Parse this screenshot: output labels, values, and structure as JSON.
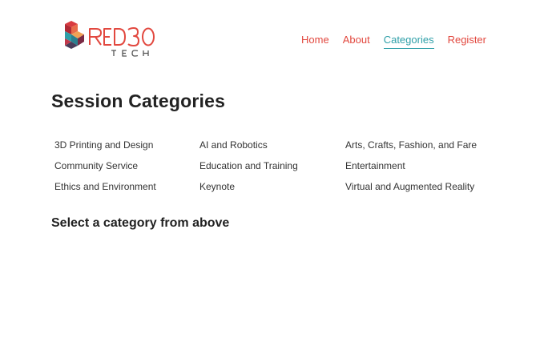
{
  "brand": {
    "wordmark": "RED30",
    "tagline": "TECH",
    "accent_color": "#e2483f"
  },
  "nav": {
    "items": [
      {
        "label": "Home"
      },
      {
        "label": "About"
      },
      {
        "label": "Categories",
        "active": true
      },
      {
        "label": "Register"
      }
    ],
    "link_color": "#e2483f",
    "active_color": "#2e9fa8"
  },
  "page": {
    "title": "Session Categories",
    "prompt": "Select a category from above"
  },
  "categories": [
    "3D Printing and Design",
    "AI and Robotics",
    "Arts, Crafts, Fashion, and Fare",
    "Community Service",
    "Education and Training",
    "Entertainment",
    "Ethics and Environment",
    "Keynote",
    "Virtual and Augmented Reality"
  ]
}
